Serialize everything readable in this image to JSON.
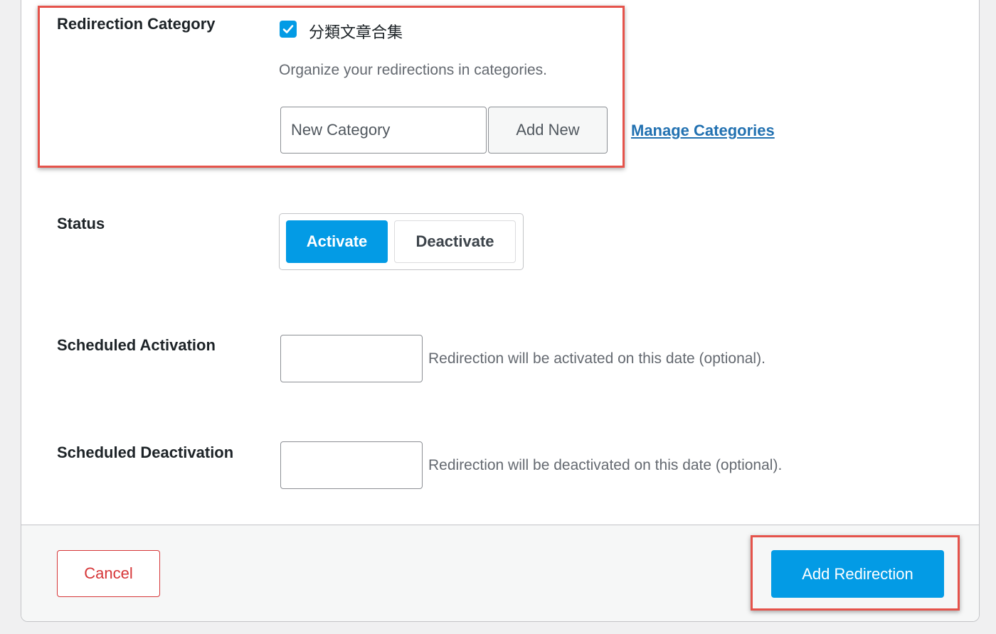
{
  "form": {
    "category": {
      "label": "Redirection Category",
      "checkbox_label": "分類文章合集",
      "checked": true,
      "description": "Organize your redirections in categories.",
      "new_category_placeholder": "New Category",
      "add_new_label": "Add New",
      "manage_link": "Manage Categories"
    },
    "status": {
      "label": "Status",
      "options": [
        "Activate",
        "Deactivate"
      ],
      "selected": "Activate"
    },
    "scheduled_activation": {
      "label": "Scheduled Activation",
      "value": "",
      "description": "Redirection will be activated on this date (optional)."
    },
    "scheduled_deactivation": {
      "label": "Scheduled Deactivation",
      "value": "",
      "description": "Redirection will be deactivated on this date (optional)."
    }
  },
  "footer": {
    "cancel_label": "Cancel",
    "submit_label": "Add Redirection"
  },
  "colors": {
    "accent": "#039be5",
    "danger": "#d63638",
    "link": "#2271b1",
    "highlight": "#e5534b"
  },
  "icons": {
    "checkbox": "check-icon"
  }
}
